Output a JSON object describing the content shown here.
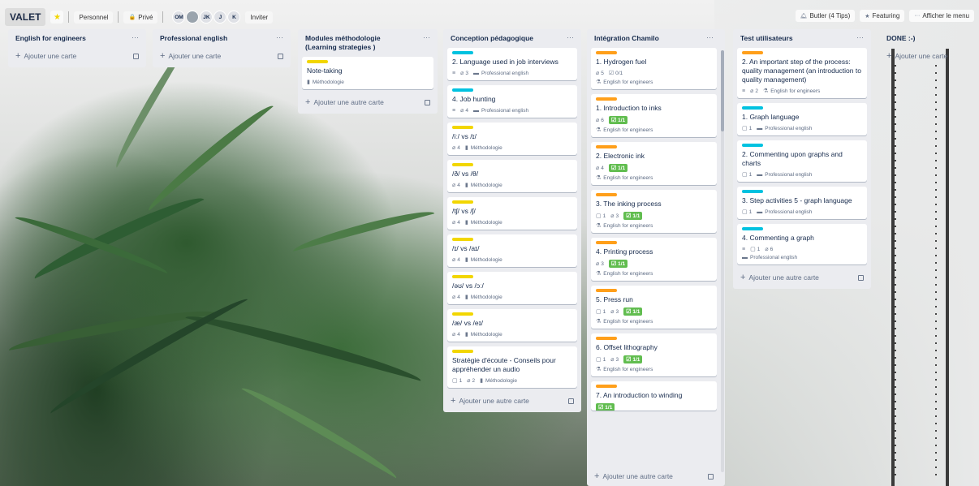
{
  "header": {
    "board_title": "VALET",
    "team": "Personnel",
    "visibility": "Privé",
    "members": [
      "OM",
      "JK",
      "J",
      "K"
    ],
    "invite": "Inviter",
    "butler": "Butler (4 Tips)",
    "featuring": "Featuring",
    "menu": "Afficher le menu"
  },
  "colors": {
    "label_blue": "#00c2e0",
    "label_orange": "#ff9f1a",
    "label_yellow": "#f2d600",
    "check_green": "#61bd4f"
  },
  "lists": [
    {
      "title": "English for engineers",
      "add": "Ajouter une carte",
      "cards": []
    },
    {
      "title": "Professional english",
      "add": "Ajouter une carte",
      "cards": []
    },
    {
      "title": "Modules méthodologie (Learning strategies )",
      "add": "Ajouter une autre carte",
      "cards": [
        {
          "title": "Note-taking",
          "tag": "Méthodologie"
        }
      ]
    },
    {
      "title": "Conception pédagogique",
      "add": "Ajouter une autre carte",
      "cards": [
        {
          "title": "2. Language used in job interviews",
          "attach": "3",
          "tag": "Professional english"
        },
        {
          "title": "4. Job hunting",
          "attach": "4",
          "tag": "Professional english"
        },
        {
          "title": "/iː/ vs /ɪ/",
          "attach": "4",
          "tag": "Méthodologie"
        },
        {
          "title": "/ð/ vs /θ/",
          "attach": "4",
          "tag": "Méthodologie"
        },
        {
          "title": "/tʃ/ vs /ʃ/",
          "attach": "4",
          "tag": "Méthodologie"
        },
        {
          "title": "/ɪ/ vs /aɪ/",
          "attach": "4",
          "tag": "Méthodologie"
        },
        {
          "title": "/əʊ/ vs /ɔː/",
          "attach": "4",
          "tag": "Méthodologie"
        },
        {
          "title": "/æ/ vs /eɪ/",
          "attach": "4",
          "tag": "Méthodologie"
        },
        {
          "title": "Stratégie d'écoute - Conseils pour appréhender un audio",
          "comments": "1",
          "attach": "2",
          "tag": "Méthodologie"
        }
      ]
    },
    {
      "title": "Intégration Chamilo",
      "add": "Ajouter une autre carte",
      "cards": [
        {
          "title": "1. Hydrogen fuel",
          "attach": "5",
          "check": "0/1",
          "tag": "English for engineers"
        },
        {
          "title": "1. Introduction to inks",
          "attach": "6",
          "check": "1/1",
          "tag": "English for engineers"
        },
        {
          "title": "2. Electronic ink",
          "attach": "4",
          "check": "1/1",
          "tag": "English for engineers"
        },
        {
          "title": "3. The inking process",
          "comments": "1",
          "attach": "3",
          "check": "1/1",
          "tag": "English for engineers"
        },
        {
          "title": "4. Printing process",
          "attach": "3",
          "check": "1/1",
          "tag": "English for engineers"
        },
        {
          "title": "5. Press run",
          "comments": "1",
          "attach": "3",
          "check": "1/1",
          "tag": "English for engineers"
        },
        {
          "title": "6. Offset lithography",
          "comments": "1",
          "attach": "3",
          "check": "1/1",
          "tag": "English for engineers"
        },
        {
          "title": "7. An introduction to winding",
          "comments": "",
          "attach": "",
          "check": "1/1"
        }
      ]
    },
    {
      "title": "Test utilisateurs",
      "add": "Ajouter une autre carte",
      "cards": [
        {
          "title": "2. An important step of the process: quality management (an introduction to quality management)",
          "attach": "2",
          "tag": "English for engineers"
        },
        {
          "title": "1. Graph language",
          "comments": "1",
          "tag": "Professional english"
        },
        {
          "title": "2. Commenting upon graphs and charts",
          "comments": "1",
          "tag": "Professional english"
        },
        {
          "title": "3. Step activities 5 - graph language",
          "comments": "1",
          "tag": "Professional english"
        },
        {
          "title": "4. Commenting a graph",
          "comments": "1",
          "attach": "6",
          "tag": "Professional english"
        }
      ]
    },
    {
      "title": "DONE :-)",
      "add": "Ajouter une carte",
      "cards": []
    }
  ]
}
